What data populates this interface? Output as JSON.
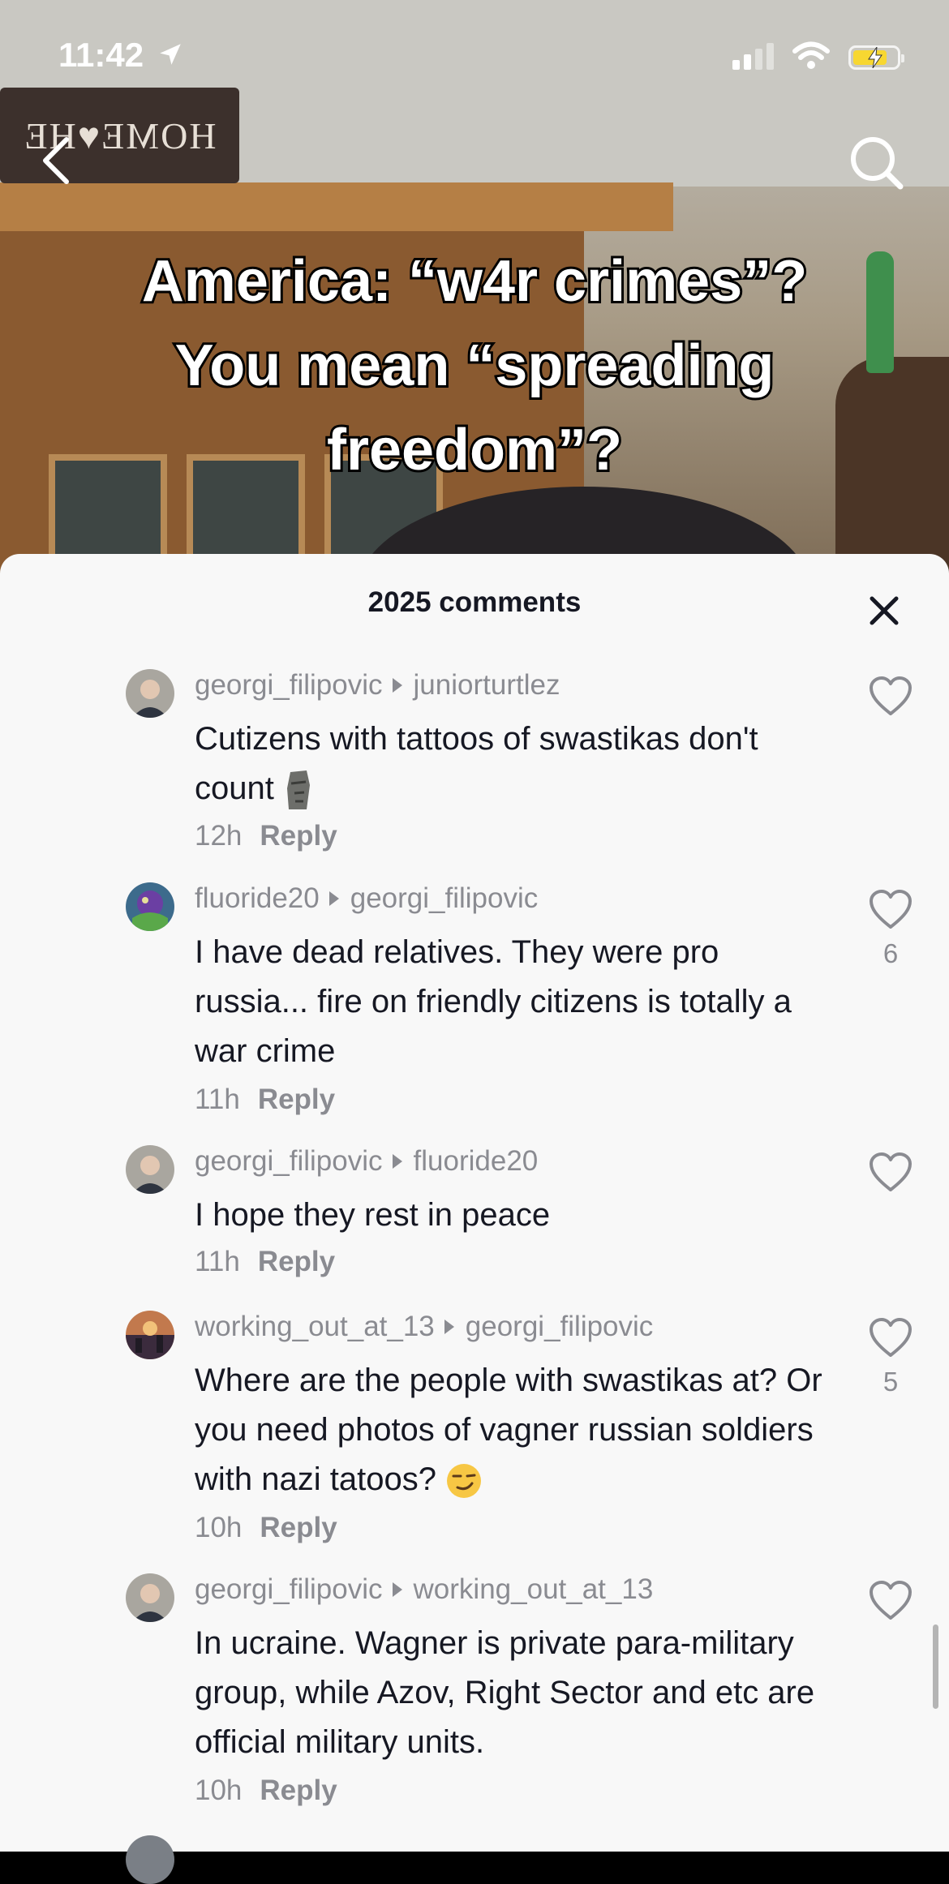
{
  "status_bar": {
    "time": "11:42"
  },
  "video": {
    "sign_text": "HOME♥HE",
    "caption_lines": [
      "America: “w4r crimes”?",
      "You mean “spreading",
      "freedom”?"
    ]
  },
  "comments_panel": {
    "title": "2025 comments",
    "comments": [
      {
        "username": "georgi_filipovic",
        "reply_to": "juniorturtlez",
        "text": "Cutizens with tattoos of swastikas don't count",
        "emoji": "moai",
        "time": "12h",
        "reply_label": "Reply",
        "likes": ""
      },
      {
        "username": "fluoride20",
        "reply_to": "georgi_filipovic",
        "text": "I have dead relatives. They were pro russia... fire on friendly citizens is totally a war crime",
        "time": "11h",
        "reply_label": "Reply",
        "likes": "6"
      },
      {
        "username": "georgi_filipovic",
        "reply_to": "fluoride20",
        "text": "I hope they rest in peace",
        "time": "11h",
        "reply_label": "Reply",
        "likes": ""
      },
      {
        "username": "working_out_at_13",
        "reply_to": "georgi_filipovic",
        "text": "Where are the people with swastikas at? Or you need photos of vagner russian soldiers with nazi tatoos?",
        "emoji": "smirk",
        "time": "10h",
        "reply_label": "Reply",
        "likes": "5"
      },
      {
        "username": "georgi_filipovic",
        "reply_to": "working_out_at_13",
        "text": "In ucraine. Wagner is private para-military group, while Azov, Right Sector and etc are official military units.",
        "time": "10h",
        "reply_label": "Reply",
        "likes": ""
      }
    ]
  }
}
